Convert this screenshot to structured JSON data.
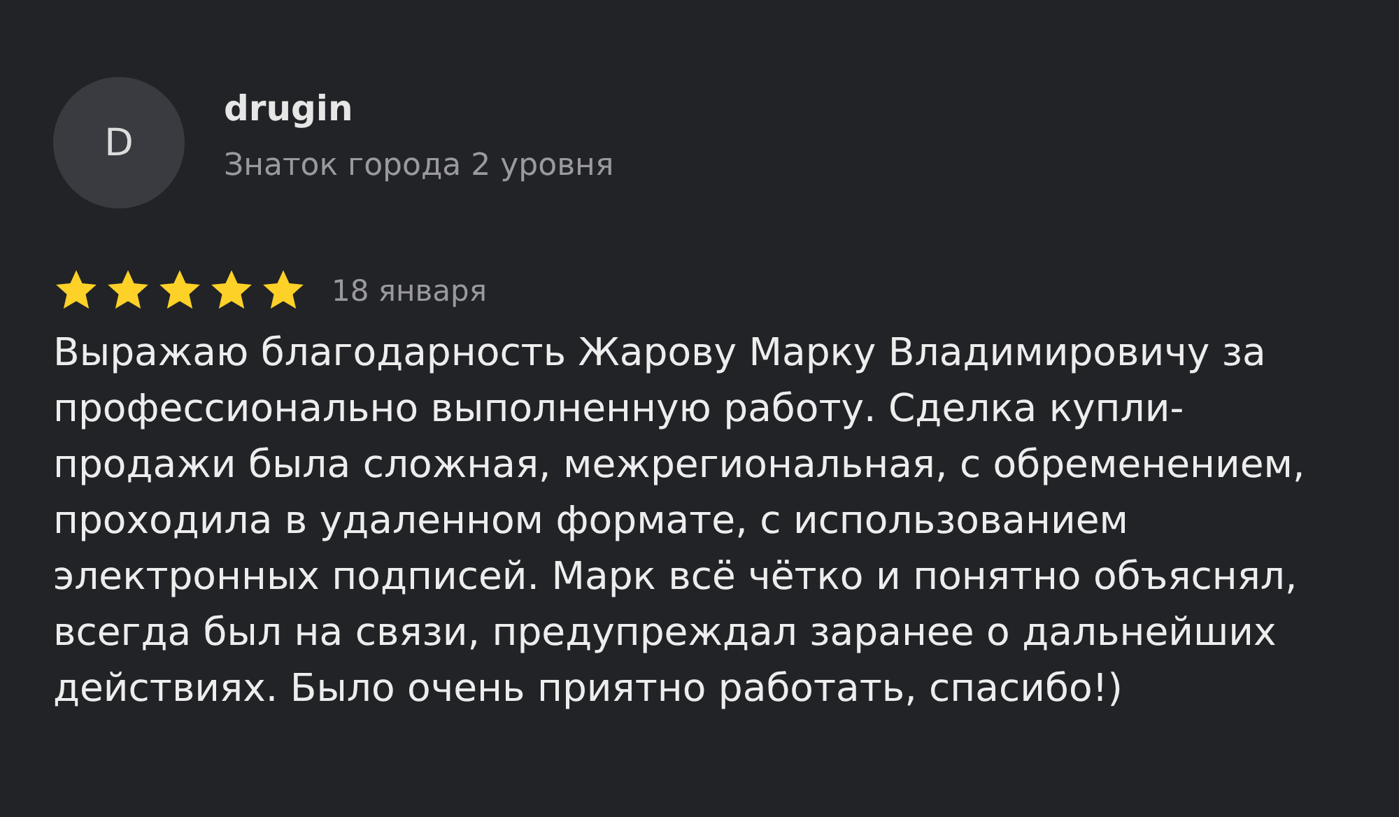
{
  "review": {
    "avatar_letter": "D",
    "author": "drugin",
    "author_level": "Знаток города 2 уровня",
    "stars": 5,
    "date": "18 января",
    "text": "Выражаю благодарность Жарову Марку Владимировичу за профессионально выполненную работу. Сделка купли-продажи была сложная, межрегиональная, с обременением,  проходила в удаленном формате, с использованием электронных подписей. Марк всё чётко и понятно объяснял, всегда был на связи, предупреждал заранее о дальнейших действиях. Было очень приятно работать, спасибо!)"
  }
}
